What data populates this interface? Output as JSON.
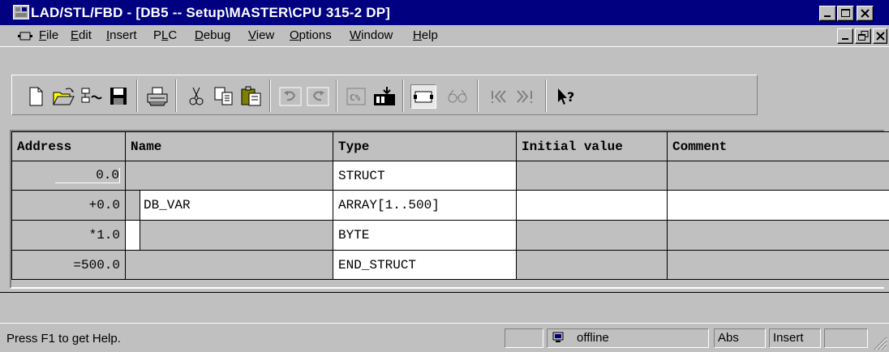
{
  "window": {
    "title": "LAD/STL/FBD  - [DB5 -- Setup\\MASTER\\CPU 315-2 DP]",
    "app_icon": "grid-app-icon",
    "minimize_glyph": "_",
    "close_glyph": "✕"
  },
  "menubar": {
    "items": [
      {
        "label": "File",
        "mnemonic": "F"
      },
      {
        "label": "Edit",
        "mnemonic": "E"
      },
      {
        "label": "Insert",
        "mnemonic": "I"
      },
      {
        "label": "PLC",
        "mnemonic": "L"
      },
      {
        "label": "Debug",
        "mnemonic": "D"
      },
      {
        "label": "View",
        "mnemonic": "V"
      },
      {
        "label": "Options",
        "mnemonic": "O"
      },
      {
        "label": "Window",
        "mnemonic": "W"
      },
      {
        "label": "Help",
        "mnemonic": "H"
      }
    ]
  },
  "toolbar": {
    "buttons": [
      "new-icon",
      "open-icon",
      "accessible-nodes-icon",
      "save-icon",
      "print-icon",
      "cut-icon",
      "copy-icon",
      "paste-icon",
      "undo-icon",
      "redo-icon",
      "load-icon",
      "download-icon",
      "overview-icon",
      "monitor-glasses-icon",
      "breakpoint-prev-icon",
      "breakpoint-next-icon",
      "context-help-icon"
    ]
  },
  "table": {
    "headers": [
      "Address",
      "Name",
      "Type",
      "Initial value",
      "Comment"
    ],
    "rows": [
      {
        "address": "0.0",
        "name": "",
        "type": "STRUCT",
        "initial": "",
        "comment": ""
      },
      {
        "address": "+0.0",
        "name": "DB_VAR",
        "type": "ARRAY[1..500]",
        "initial": "",
        "comment": ""
      },
      {
        "address": "*1.0",
        "name": "",
        "type": "BYTE",
        "initial": "",
        "comment": ""
      },
      {
        "address": "=500.0",
        "name": "",
        "type": "END_STRUCT",
        "initial": "",
        "comment": ""
      }
    ]
  },
  "statusbar": {
    "help_text": "Press F1 to get Help.",
    "connection": "offline",
    "address_mode": "Abs",
    "edit_mode": "Insert"
  },
  "colors": {
    "title_bg": "#000080",
    "face": "#c0c0c0",
    "cell_white": "#ffffff"
  }
}
